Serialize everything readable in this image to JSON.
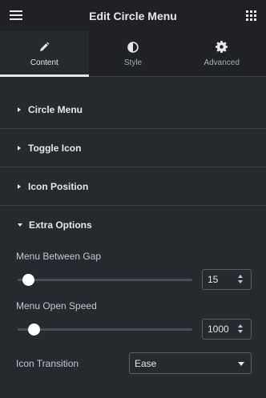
{
  "header": {
    "title": "Edit Circle Menu"
  },
  "tabs": [
    {
      "label": "Content",
      "icon": "pencil-icon",
      "active": true
    },
    {
      "label": "Style",
      "icon": "half-circle-icon",
      "active": false
    },
    {
      "label": "Advanced",
      "icon": "gear-icon",
      "active": false
    }
  ],
  "sections": [
    {
      "label": "Circle Menu",
      "expanded": false
    },
    {
      "label": "Toggle Icon",
      "expanded": false
    },
    {
      "label": "Icon Position",
      "expanded": false
    },
    {
      "label": "Extra Options",
      "expanded": true
    }
  ],
  "extra_options": {
    "menu_gap": {
      "label": "Menu Between Gap",
      "value": "15",
      "level": 0.06
    },
    "open_speed": {
      "label": "Menu Open Speed",
      "value": "1000",
      "level": 0.09
    },
    "icon_transition": {
      "label": "Icon Transition",
      "value": "Ease"
    }
  },
  "colors": {
    "background": "#26292e",
    "header": "#1f2124",
    "text": "#e6e8ea"
  }
}
